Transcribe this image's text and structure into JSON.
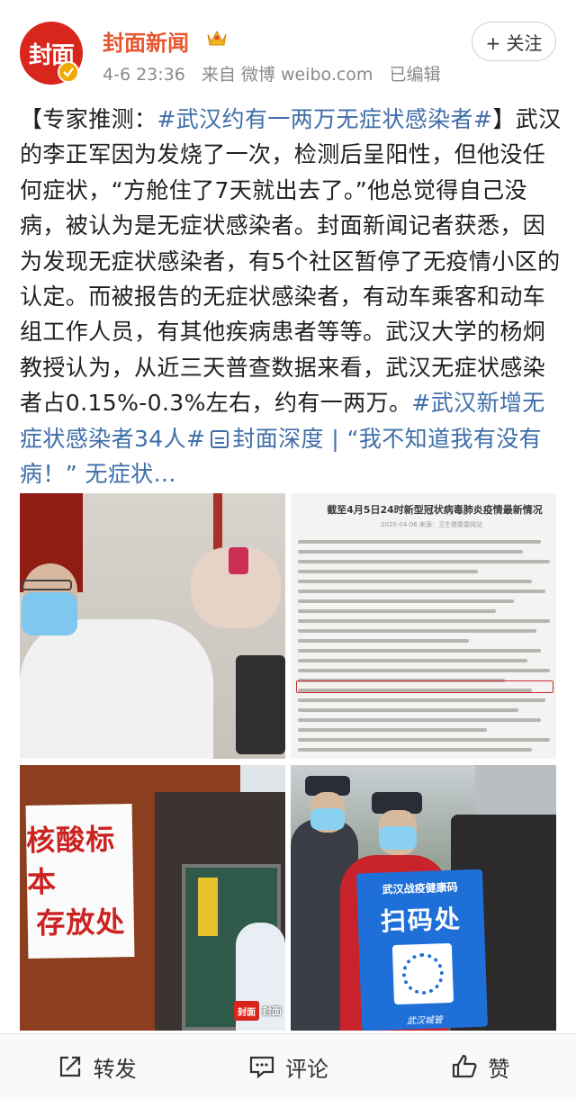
{
  "header": {
    "avatar_text": "封面",
    "name": "封面新闻",
    "time": "4-6 23:36",
    "source": "来自 微博 weibo.com",
    "edited": "已编辑",
    "follow_label": "+ 关注"
  },
  "post": {
    "bracket_open": "【专家推测：",
    "topic1": "#武汉约有一两万无症状感染者#",
    "body1": "】武汉的李正军因为发烧了一次，检测后呈阳性，但他没任何症状，“方舱住了7天就出去了。”他总觉得自己没病，被认为是无症状感染者。封面新闻记者获悉，因为发现无症状感染者，有5个社区暂停了无疫情小区的认定。而被报告的无症状感染者，有动车乘客和动车组工作人员，有其他疾病患者等等。武汉大学的杨炯教授认为，从近三天普查数据来看，武汉无症状感染者占0.15%-0.3%左右，约有一两万。",
    "topic2": "#武汉新增无症状感染者34人#",
    "link": "封面深度 | “我不知道我有没有病！” 无症状...",
    "link_icon": "article-icon"
  },
  "images": {
    "doc_title": "截至4月5日24时新型冠状病毒肺炎疫情最新情况",
    "doc_sub": "2020-04-06 来源：卫生健康委网站",
    "sign_line1": "核酸标本",
    "sign_line2": "存放处",
    "watermark": "封面",
    "watermark_text": "封面",
    "qr_title": "武汉战疫健康码",
    "qr_big": "扫码处",
    "qr_foot": "武汉城管"
  },
  "bottom_bar": {
    "repost": "转发",
    "comment": "评论",
    "like": "赞"
  },
  "colors": {
    "brand_red": "#d9261c",
    "name_orange": "#e5582f",
    "link_blue": "#3f6ea8"
  }
}
